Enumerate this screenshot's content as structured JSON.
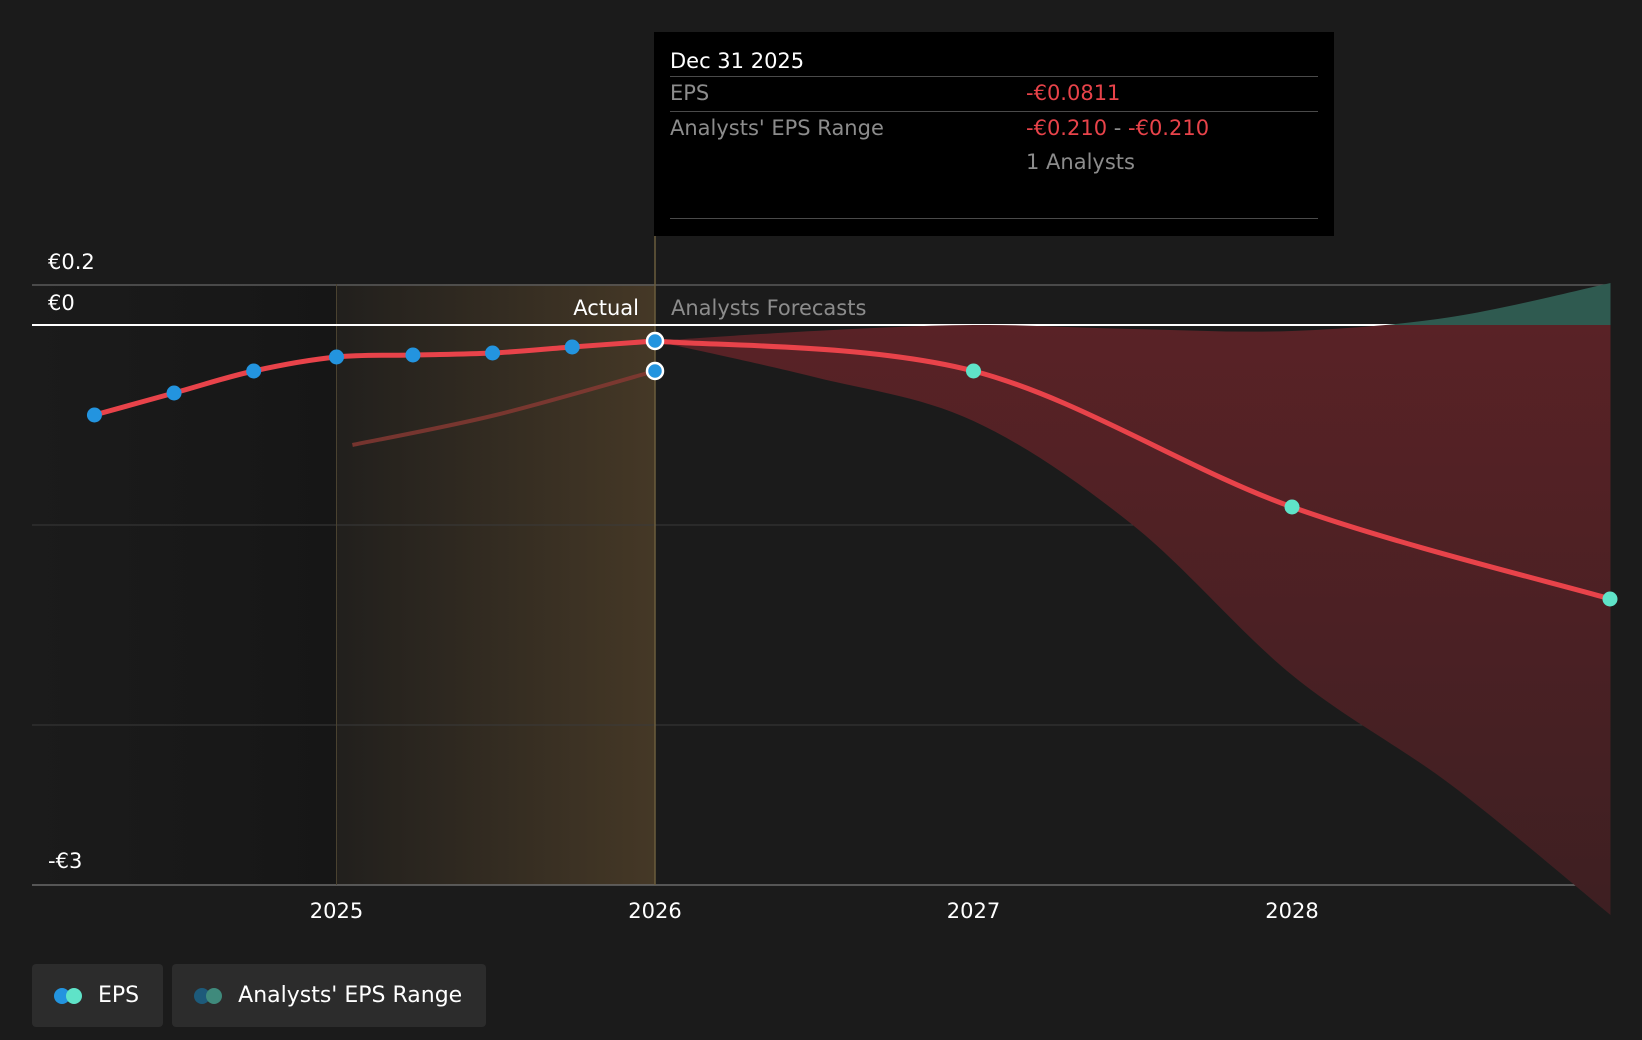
{
  "chart_data": {
    "type": "line",
    "y_tick_labels": [
      "€0.2",
      "€0",
      "-€3"
    ],
    "x_tick_labels": [
      "2025",
      "2026",
      "2027",
      "2028"
    ],
    "region_labels": {
      "actual": "Actual",
      "forecast": "Analysts Forecasts"
    },
    "ylim": [
      -3,
      0.2
    ],
    "grid": true,
    "series": [
      {
        "name": "EPS",
        "kind": "actual",
        "x": [
          2024.24,
          2024.49,
          2024.74,
          2025.0,
          2025.24,
          2025.49,
          2025.74,
          2026.0
        ],
        "values": [
          -0.45,
          -0.34,
          -0.23,
          -0.16,
          -0.15,
          -0.14,
          -0.11,
          -0.08
        ]
      },
      {
        "name": "EPS",
        "kind": "forecast",
        "x": [
          2026.0,
          2027.0,
          2028.0,
          2029.0
        ],
        "values": [
          -0.08,
          -0.23,
          -0.91,
          -1.37
        ]
      },
      {
        "name": "Analysts' EPS Range",
        "kind": "range",
        "x": [
          2026.0,
          2026.5,
          2027.0,
          2027.5,
          2028.0,
          2028.5,
          2029.0
        ],
        "low": [
          -0.08,
          -0.26,
          -0.48,
          -1.0,
          -1.75,
          -2.3,
          -2.95
        ],
        "high": [
          -0.08,
          -0.03,
          0.0,
          -0.02,
          -0.03,
          0.04,
          0.21
        ]
      },
      {
        "name": "Analysts' EPS Range",
        "kind": "past-estimates",
        "x": [
          2025.05,
          2025.5,
          2026.0
        ],
        "values": [
          -0.6,
          -0.45,
          -0.23
        ]
      }
    ],
    "highlight": {
      "x": 2026.0,
      "eps": -0.08,
      "estimate": -0.23
    }
  },
  "tooltip": {
    "date": "Dec 31 2025",
    "eps_label": "EPS",
    "eps_value": "-€0.0811",
    "range_label": "Analysts' EPS Range",
    "range_low": "-€0.210",
    "range_sep": " - ",
    "range_high": "-€0.210",
    "analysts": "1 Analysts"
  },
  "legend": [
    {
      "label": "EPS",
      "colors": [
        "#2394df",
        "#5fe3c8"
      ]
    },
    {
      "label": "Analysts' EPS Range",
      "colors": [
        "#1d5a7a",
        "#3f8a7c"
      ]
    }
  ],
  "colors": {
    "background": "#1b1b1b",
    "eps_line": "#e8434a",
    "actual_dot": "#2394df",
    "forecast_dot": "#5fe3c8",
    "range_negative": "#5b2226",
    "range_positive": "#2f5a50",
    "actual_band": "#453826"
  }
}
